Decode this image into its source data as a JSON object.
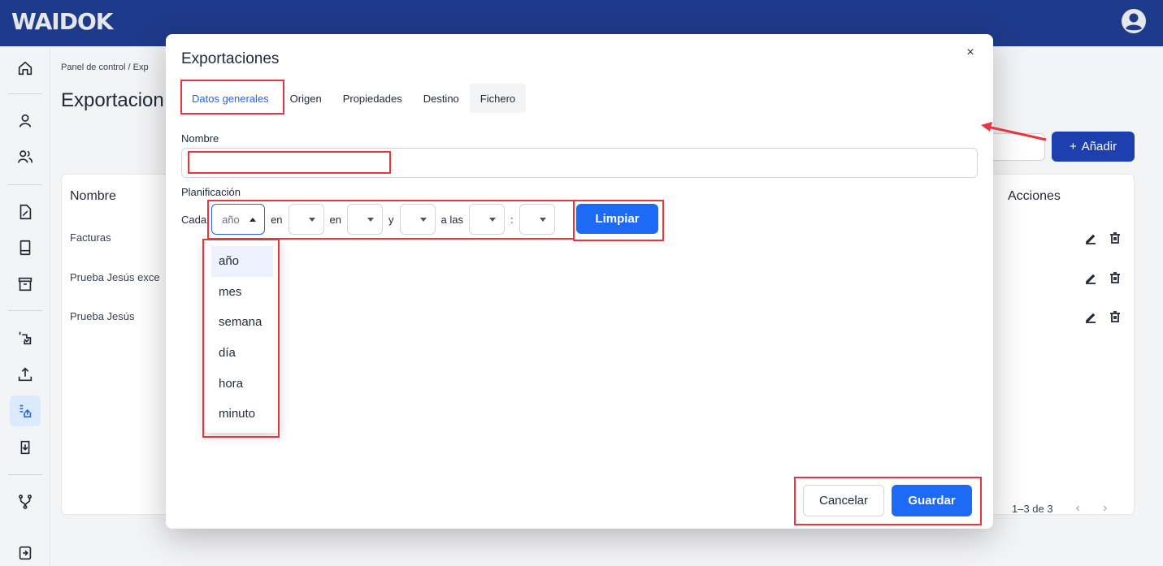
{
  "app": {
    "logo": "WAIDOK"
  },
  "background": {
    "breadcrumb": "Panel de control  /  Exp",
    "page_title": "Exportacion",
    "add_button": "Añadir",
    "table": {
      "headers": {
        "name": "Nombre",
        "actions": "Acciones"
      },
      "rows": [
        {
          "name": "Facturas"
        },
        {
          "name": "Prueba Jesús exce"
        },
        {
          "name": "Prueba Jesús"
        }
      ]
    },
    "pagination": {
      "range": "1–3 de 3"
    }
  },
  "sidebar": {
    "icons": [
      "home-icon",
      "user-icon",
      "users-icon",
      "document-edit-icon",
      "book-icon",
      "archive-icon",
      "transfer-icon",
      "upload-icon",
      "export-list-icon",
      "import-icon",
      "workflow-icon",
      "logout-icon"
    ],
    "active": "export-list-icon"
  },
  "modal": {
    "title": "Exportaciones",
    "close": "×",
    "tabs": [
      {
        "label": "Datos generales",
        "active": true
      },
      {
        "label": "Origen",
        "active": false
      },
      {
        "label": "Propiedades",
        "active": false
      },
      {
        "label": "Destino",
        "active": false
      },
      {
        "label": "Fichero",
        "active": false
      }
    ],
    "nombre_label": "Nombre",
    "nombre_value": "",
    "planificacion_label": "Planificación",
    "schedule": {
      "cada": "Cada",
      "period_value": "año",
      "en1": "en",
      "en2": "en",
      "y": "y",
      "a_las": "a las",
      "colon": ":"
    },
    "limpiar": "Limpiar",
    "dropdown_options": [
      "año",
      "mes",
      "semana",
      "día",
      "hora",
      "minuto"
    ],
    "cancel": "Cancelar",
    "save": "Guardar"
  },
  "colors": {
    "primary": "#1d6af5",
    "topbar": "#1e3a8a",
    "annotation": "#e8363f"
  }
}
